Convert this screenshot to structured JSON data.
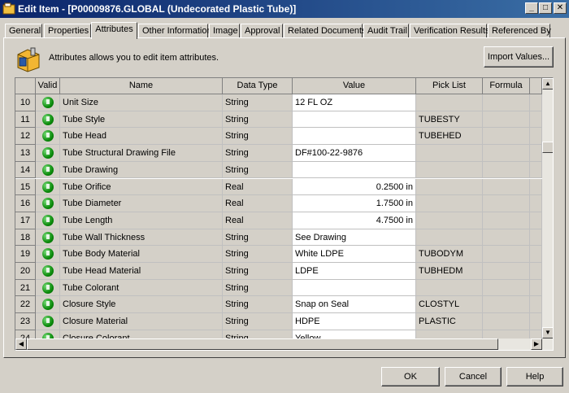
{
  "window": {
    "title": "Edit Item - [P00009876.GLOBAL (Undecorated Plastic Tube)]"
  },
  "tabs": [
    {
      "label": "General"
    },
    {
      "label": "Properties"
    },
    {
      "label": "Attributes"
    },
    {
      "label": "Other Information"
    },
    {
      "label": "Image"
    },
    {
      "label": "Approval"
    },
    {
      "label": "Related Documents"
    },
    {
      "label": "Audit Trail"
    },
    {
      "label": "Verification Results"
    },
    {
      "label": "Referenced By"
    }
  ],
  "active_tab": "Attributes",
  "info": {
    "text": "Attributes allows you to edit item attributes."
  },
  "import_button": "Import Values...",
  "grid": {
    "columns": [
      "Valid",
      "Name",
      "Data Type",
      "Value",
      "Pick List",
      "Formula"
    ],
    "rows": [
      {
        "num": "10",
        "name": "Unit Size",
        "type": "String",
        "value": "12 FL OZ",
        "pick": ""
      },
      {
        "num": "11",
        "name": "Tube Style",
        "type": "String",
        "value": "",
        "pick": "TUBESTY"
      },
      {
        "num": "12",
        "name": "Tube Head",
        "type": "String",
        "value": "",
        "pick": "TUBEHED"
      },
      {
        "num": "13",
        "name": "Tube Structural Drawing File",
        "type": "String",
        "value": "DF#100-22-9876",
        "pick": ""
      },
      {
        "num": "14",
        "name": "Tube Drawing",
        "type": "String",
        "value": "",
        "pick": ""
      },
      {
        "num": "15",
        "name": "Tube Orifice",
        "type": "Real",
        "value": "0.2500 in",
        "pick": ""
      },
      {
        "num": "16",
        "name": "Tube Diameter",
        "type": "Real",
        "value": "1.7500 in",
        "pick": ""
      },
      {
        "num": "17",
        "name": "Tube Length",
        "type": "Real",
        "value": "4.7500 in",
        "pick": ""
      },
      {
        "num": "18",
        "name": "Tube Wall Thickness",
        "type": "String",
        "value": "See Drawing",
        "pick": ""
      },
      {
        "num": "19",
        "name": "Tube Body Material",
        "type": "String",
        "value": "White LDPE",
        "pick": "TUBODYM"
      },
      {
        "num": "20",
        "name": "Tube Head Material",
        "type": "String",
        "value": "LDPE",
        "pick": "TUBHEDM"
      },
      {
        "num": "21",
        "name": "Tube Colorant",
        "type": "String",
        "value": "",
        "pick": ""
      },
      {
        "num": "22",
        "name": "Closure Style",
        "type": "String",
        "value": "Snap on Seal",
        "pick": "CLOSTYL"
      },
      {
        "num": "23",
        "name": "Closure Material",
        "type": "String",
        "value": "HDPE",
        "pick": "PLASTIC"
      },
      {
        "num": "24",
        "name": "Closure Colorant",
        "type": "String",
        "value": "Yellow",
        "pick": ""
      }
    ]
  },
  "buttons": {
    "ok": "OK",
    "cancel": "Cancel",
    "help": "Help"
  },
  "colors": {
    "titlebar": "#0a246a",
    "valid_dot": "#0a8a0a",
    "face": "#d4d0c8"
  }
}
